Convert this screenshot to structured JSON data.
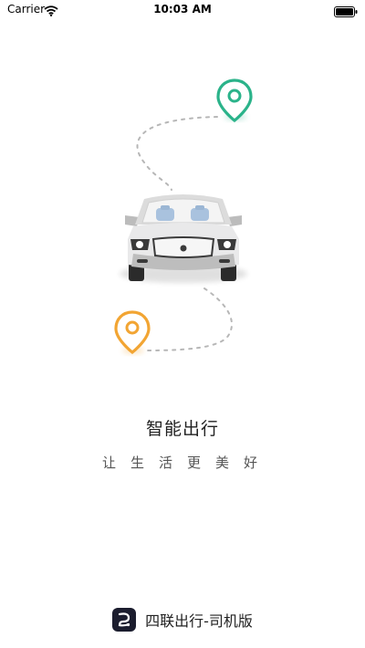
{
  "status_bar": {
    "carrier": "Carrier",
    "time": "10:03 AM"
  },
  "splash": {
    "headline": "智能出行",
    "slogan": "让生活更美好"
  },
  "brand": {
    "app_name": "四联出行-司机版"
  },
  "icons": [
    "wifi-icon",
    "battery-icon",
    "destination-pin-icon",
    "origin-pin-icon",
    "car-illustration",
    "app-logo-icon"
  ],
  "colors": {
    "destination_pin": "#2bb38a",
    "origin_pin": "#f2a533",
    "route_dots": "#b7b7b7",
    "car_body": "#e9e9ea",
    "app_icon_bg": "#1b1d2e"
  }
}
